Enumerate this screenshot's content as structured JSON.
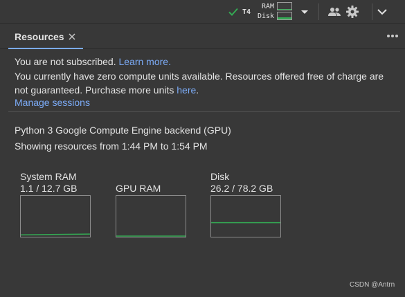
{
  "topbar": {
    "gpu": "T4",
    "ram_label": "RAM",
    "disk_label": "Disk",
    "ram_usage_fraction": 0.09,
    "disk_usage_fraction": 0.33,
    "icons": [
      "check-icon",
      "caret-down-icon",
      "people-icon",
      "gear-icon",
      "chevron-down-icon"
    ]
  },
  "tab": {
    "label": "Resources",
    "close_icon": "close-icon",
    "more_icon": "more-horizontal-icon"
  },
  "notice": {
    "not_subscribed": "You are not subscribed.",
    "learn_more": "Learn more.",
    "compute_units": "You currently have zero compute units available. Resources offered free of charge are not guaranteed. Purchase more units",
    "here_link": "here",
    "period": ".",
    "manage_sessions": "Manage sessions"
  },
  "backend": {
    "description": "Python 3 Google Compute Engine backend (GPU)",
    "time_range": "Showing resources from 1:44 PM to 1:54 PM"
  },
  "graphs": {
    "system_ram": {
      "title": "System RAM",
      "usage": "1.1 / 12.7 GB",
      "fraction": [
        0.03,
        0.05
      ]
    },
    "gpu_ram": {
      "title": "GPU RAM",
      "usage": "",
      "fraction": [
        0.0,
        0.0
      ]
    },
    "disk": {
      "title": "Disk",
      "usage": "26.2 / 78.2 GB",
      "fraction": [
        0.34,
        0.34
      ]
    }
  },
  "colors": {
    "accent": "#7cacf8",
    "usage_line": "#34a853",
    "background": "#383838"
  },
  "watermark": "CSDN @Antrn"
}
